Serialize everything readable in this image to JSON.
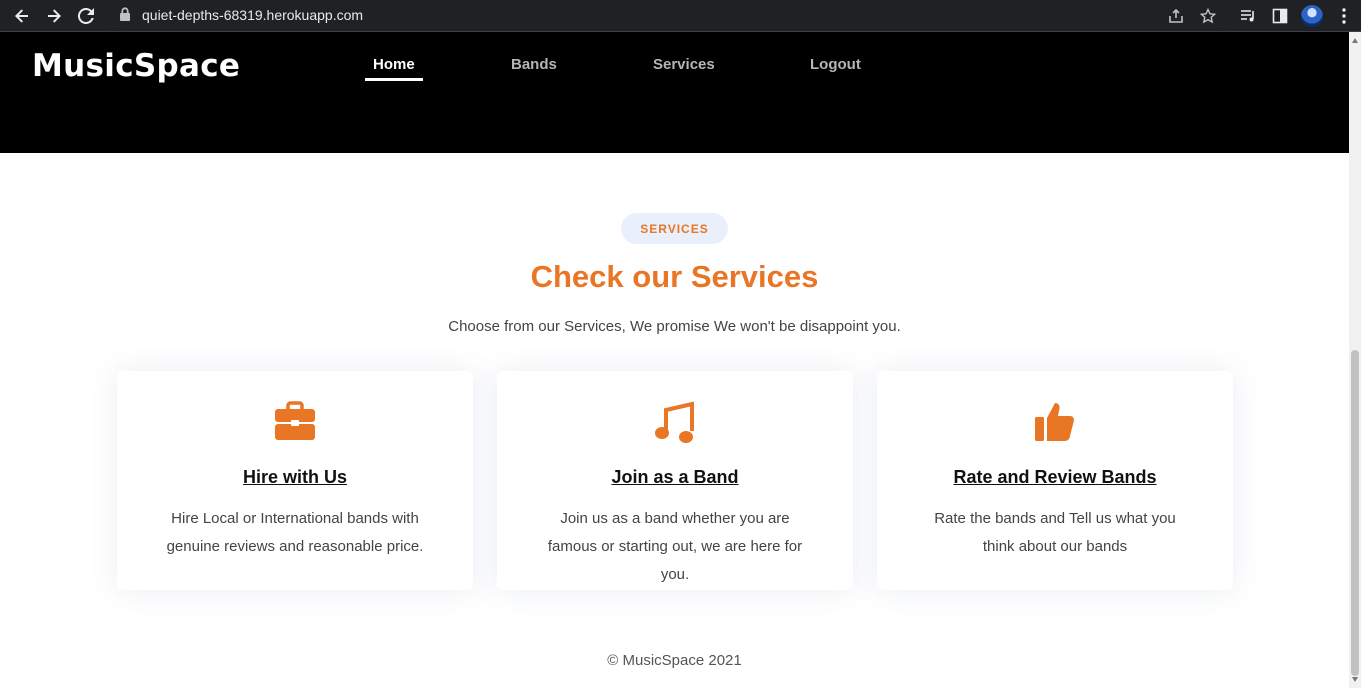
{
  "browser": {
    "url": "quiet-depths-68319.herokuapp.com"
  },
  "site": {
    "brand": "MusicSpace",
    "nav": [
      {
        "label": "Home",
        "active": true
      },
      {
        "label": "Bands",
        "active": false
      },
      {
        "label": "Services",
        "active": false
      },
      {
        "label": "Logout",
        "active": false
      }
    ]
  },
  "services": {
    "badge": "SERVICES",
    "title": "Check our Services",
    "subtitle": "Choose from our Services, We promise We won't be disappoint you.",
    "cards": [
      {
        "icon": "briefcase-icon",
        "title": "Hire with Us",
        "description": "Hire Local or International bands with genuine reviews and reasonable price."
      },
      {
        "icon": "music-note-icon",
        "title": "Join as a Band",
        "description": "Join us as a band whether you are famous or starting out, we are here for you."
      },
      {
        "icon": "thumbs-up-icon",
        "title": "Rate and Review Bands",
        "description": "Rate the bands and Tell us what you think about our bands"
      }
    ]
  },
  "footer": {
    "copyright": "© MusicSpace 2021"
  },
  "colors": {
    "accent": "#e87625",
    "header_bg": "#000000",
    "badge_bg": "#e9f0fb"
  }
}
